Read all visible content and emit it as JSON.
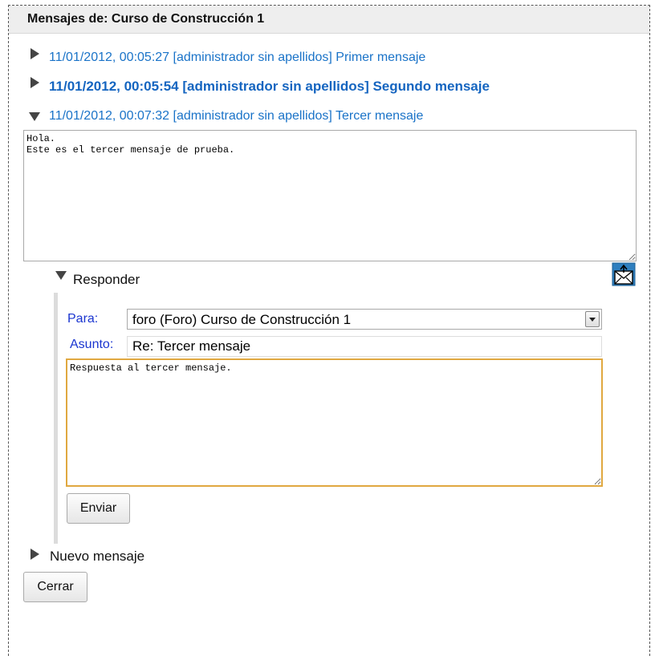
{
  "panel": {
    "title": "Mensajes de: Curso de Construcción 1"
  },
  "messages": [
    {
      "label": "11/01/2012, 00:05:27 [administrador sin apellidos] Primer mensaje",
      "expanded": false,
      "bold": false
    },
    {
      "label": "11/01/2012, 00:05:54 [administrador sin apellidos] Segundo mensaje",
      "expanded": false,
      "bold": true
    },
    {
      "label": "11/01/2012, 00:07:32 [administrador sin apellidos] Tercer mensaje",
      "expanded": true,
      "bold": false
    }
  ],
  "message_body": "Hola.\nEste es el tercer mensaje de prueba.",
  "reply": {
    "toggle_label": "Responder",
    "to_label": "Para:",
    "to_value": "foro (Foro) Curso de Construcción 1",
    "subject_label": "Asunto:",
    "subject_value": "Re: Tercer mensaje",
    "body": "Respuesta al tercer mensaje.",
    "send_label": "Enviar",
    "mail_icon": "mail-reply-icon"
  },
  "new_message_label": "Nuevo mensaje",
  "close_label": "Cerrar",
  "colors": {
    "link": "#1a73c8",
    "label_blue": "#1a35d0",
    "focus_border": "#e0a840"
  }
}
